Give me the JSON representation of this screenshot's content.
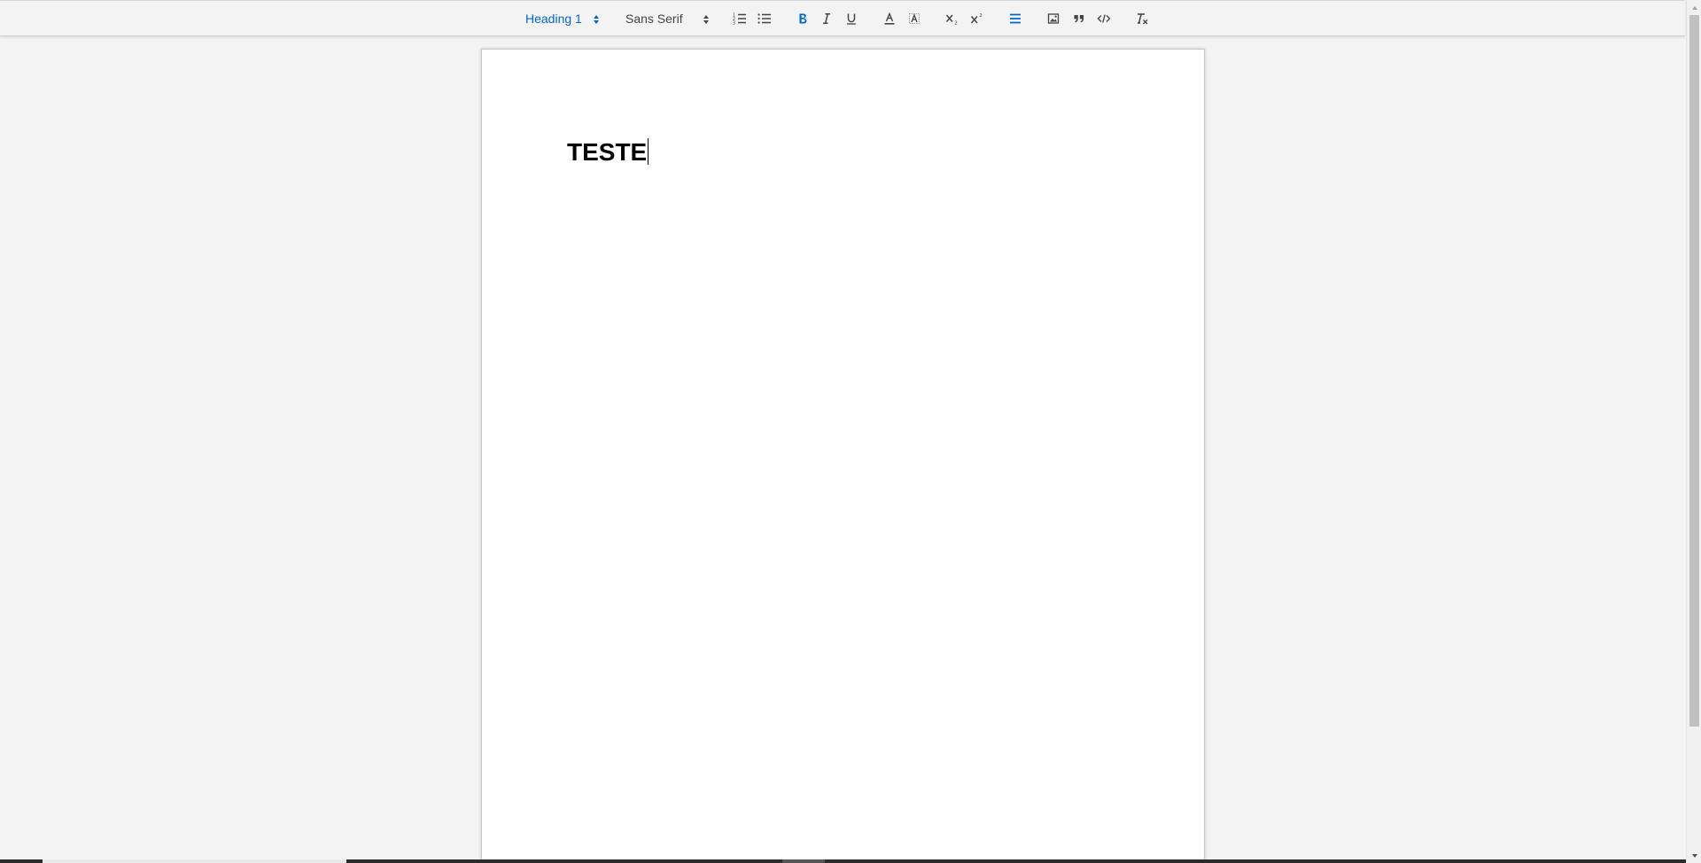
{
  "toolbar": {
    "header_picker": {
      "label": "Heading 1",
      "active_color": "#0066cc"
    },
    "font_picker": {
      "label": "Sans Serif"
    },
    "buttons": [
      "ordered-list",
      "bullet-list",
      "bold",
      "italic",
      "underline",
      "text-color",
      "background-color",
      "subscript",
      "superscript",
      "align",
      "image",
      "blockquote",
      "code-block",
      "clean-formatting"
    ]
  },
  "document": {
    "heading_text": "TESTE"
  },
  "colors": {
    "background": "#f3f3f3",
    "page": "#ffffff",
    "active": "#0066cc",
    "icon": "#444444"
  }
}
